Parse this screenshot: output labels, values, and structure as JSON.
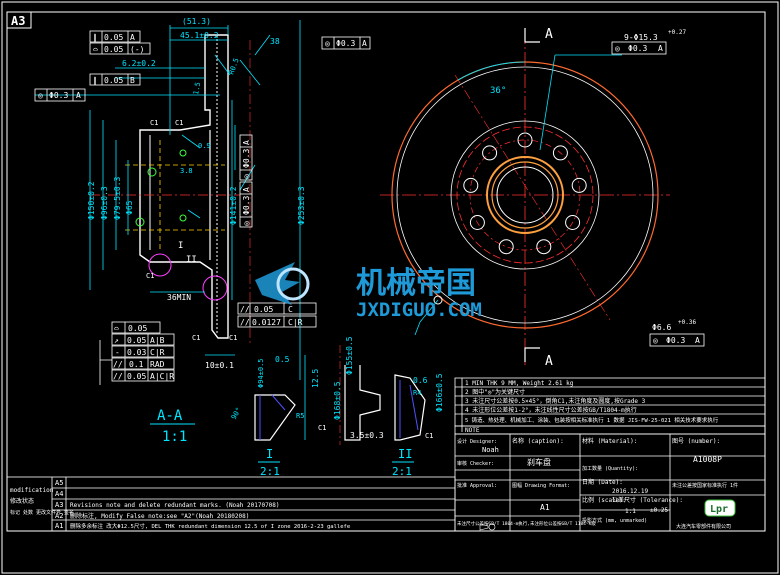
{
  "sheet": {
    "size_label": "A3"
  },
  "colors": {
    "bg": "#000000",
    "frame": "#ffffff",
    "outline": "#ffffff",
    "dim": "#00e5ff",
    "center": "#ff3030",
    "hidden": "#ffd000",
    "accent": "#ff40ff",
    "bore": "#ffa040",
    "section": "#5050ff",
    "logo": "#1e9ad8"
  },
  "section_view": {
    "dims": {
      "d_513": "(51.3)",
      "d_451": "45.1±0.2",
      "d_62": "6.2±0.2",
      "d_38a": "38",
      "d_r05": "R0.5",
      "d_15": "1.5",
      "d_09": "0.9",
      "d_38b": "3.8",
      "d_dia1501": "Φ150±0.2",
      "d_dia960": "Φ96±0.3",
      "d_dia795": "Φ79.5±0.3",
      "d_dia650": "Φ65",
      "d_dia1411": "Φ141±0.2",
      "d_dia2530": "Φ253±0.3",
      "d_36min": "36MIN",
      "d_10": "10±0.1",
      "c1": "C1"
    },
    "fcf_top": [
      {
        "sym": "∥",
        "tol": "0.05",
        "datum": "A"
      },
      {
        "sym": "⌓",
        "tol": "0.05",
        "datum": "(-)"
      },
      {
        "sym": "∥",
        "tol": "0.05",
        "datum": "B"
      }
    ],
    "fcf_left": {
      "sym": "◎",
      "tol": "Φ0.3",
      "datum": "A"
    },
    "fcf_top_right": {
      "sym": "◎",
      "tol": "Φ0.3",
      "datum": "A"
    },
    "fcf_mid": [
      {
        "sym": "◎",
        "tol": "Φ0.3",
        "datum": "A"
      },
      {
        "sym": "◎",
        "tol": "Φ0.3",
        "datum": "A"
      }
    ],
    "fcf_bot_right": [
      {
        "sym": "//",
        "tol": "0.05",
        "datum": "C"
      },
      {
        "sym": "//",
        "tol": "0.0127",
        "datum": "C|R"
      }
    ],
    "fcf_bot_left": [
      {
        "sym": "⌓",
        "tol": "0.05",
        "datum": ""
      },
      {
        "sym": "↗",
        "tol": "0.05",
        "datum": "A|B"
      },
      {
        "sym": "-",
        "tol": "0.03",
        "datum": "C|R"
      },
      {
        "sym": "//",
        "tol": "0.1",
        "datum": "RAD"
      },
      {
        "sym": "//",
        "tol": "0.05",
        "datum": "A|C|R"
      }
    ],
    "title": "A-A",
    "scale": "1:1",
    "markers": [
      "I",
      "II",
      "A",
      "B",
      "C"
    ]
  },
  "front_view": {
    "angle": "36°",
    "holes_note": "9-Φ15.3",
    "holes_tol": "+0.27",
    "fcf_holes": {
      "sym": "◎",
      "tol": "Φ0.3",
      "datum": "A"
    },
    "small_hole": "Φ6.6",
    "small_hole_tol": "+0.36",
    "fcf_small": {
      "sym": "◎",
      "tol": "Φ0.3",
      "datum": "A"
    },
    "cut_label": "A"
  },
  "detail_I": {
    "roman": "I",
    "scale": "2:1",
    "dims": [
      "0.5",
      "Φ94±0.5",
      "12.5",
      "R5",
      "90°",
      "C1"
    ]
  },
  "detail_mid": {
    "dims": [
      "Φ155±0.5",
      "Φ168±0.5",
      "3.5±0.3"
    ]
  },
  "detail_II": {
    "roman": "II",
    "scale": "2:1",
    "dims": [
      "0.6",
      "R4",
      "Φ166±0.5",
      "C1"
    ]
  },
  "notes": [
    "1 MIN THK 9 MM, Weight 2.61 kg",
    "2 图中\"◎\"为关键尺寸",
    "3 未注尺寸公差按0.5×45°，倒角C1,未注角度及圆度,按Grade 3",
    "4 未注形位公差按1-2°，未注线性尺寸公差按GB/T1804-m执行",
    "5 铸造、热处理、机械加工、涂装、包装按相关标准执行 1 数据 JIS-FW-25-021 相关技术要求执行"
  ],
  "notes_header": "NOTE",
  "title_block": {
    "designer_label": "设计 Designer:",
    "designer": "Noah",
    "caption_label": "名称 (caption):",
    "caption_value": "刹车盘",
    "material_label": "材料 (Material):",
    "number_label": "图号 (number):",
    "number_value": "A1008P",
    "checker_label": "审核 Checker:",
    "quantity_label": "加工数量 (Quantity):",
    "quantity_value": "未注公差按国家标准执行 1件",
    "approval_label": "批准 Approval:",
    "date_label": "日期 (Date):",
    "date_value": "2016.12.19",
    "drawing_format_label": "图幅 Drawing Format:",
    "drawing_format_value": "A1",
    "scale_label": "比例 (scale):",
    "scale_value": "1:1",
    "tolerance_label": "公差尺寸 (Tolerance):",
    "tolerance_value": "±0.25",
    "sheet_label": "投影方式 (mm, unmarked)",
    "company_note": "未注尺寸公差按GB/T 1804-m执行,未注形位公差按GB/T 1184-K级",
    "logo_text": "Lpr",
    "company_name": "大连汽车零部件有限公司"
  },
  "revisions": {
    "side_label_en": "modification",
    "side_label_cn": "修改状态",
    "side_label_extra": "标记 处数 更改文件号 签名",
    "rows": [
      {
        "rev": "A5",
        "text": ""
      },
      {
        "rev": "A4",
        "text": ""
      },
      {
        "rev": "A3",
        "text": "Revisions note and delete redundant marks. (Noah 20170708)"
      },
      {
        "rev": "A2",
        "text": "删除标注, Modify False note:see \"A2\"(Noah 20180208)"
      },
      {
        "rev": "A1",
        "text": "删除多余标注 改大Φ12.5尺寸, DEL THK redundant dimension 12.5 of I zone  2016-2-23 gallefe"
      }
    ]
  },
  "watermark": {
    "cn": "机械帝国",
    "en": "JXDIGUO.COM"
  }
}
